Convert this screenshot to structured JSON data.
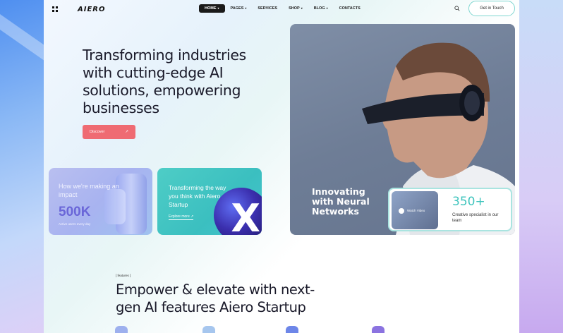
{
  "header": {
    "logo": "AIERO",
    "nav": [
      {
        "label": "HOME",
        "has_caret": true,
        "active": true
      },
      {
        "label": "PAGES",
        "has_caret": true,
        "active": false
      },
      {
        "label": "SERVICES",
        "has_caret": false,
        "active": false
      },
      {
        "label": "SHOP",
        "has_caret": true,
        "active": false
      },
      {
        "label": "BLOG",
        "has_caret": true,
        "active": false
      },
      {
        "label": "CONTACTS",
        "has_caret": false,
        "active": false
      }
    ],
    "cta_label": "Get in Touch"
  },
  "hero": {
    "title": "Transforming industries with cutting-edge AI solutions, empowering businesses",
    "button_label": "Discover",
    "button_icon": "arrow-up-right-icon"
  },
  "card_impact": {
    "text": "How we're making an impact",
    "number": "500K",
    "sub": "Active users every day"
  },
  "card_transform": {
    "text": "Transforming the way you think with Aiero Startup",
    "link": "Explore more"
  },
  "photo_card": {
    "title": "Innovating with Neural Networks",
    "thumb_label": "Watch Video",
    "stat_number": "350+",
    "stat_text": "Creative specialist in our team"
  },
  "features": {
    "tag": "[ features ]",
    "title": "Empower & elevate with next-gen AI features Aiero Startup"
  },
  "colors": {
    "accent_coral": "#ef6b73",
    "accent_teal": "#3fc4bd",
    "accent_violet": "#6a66d8"
  }
}
